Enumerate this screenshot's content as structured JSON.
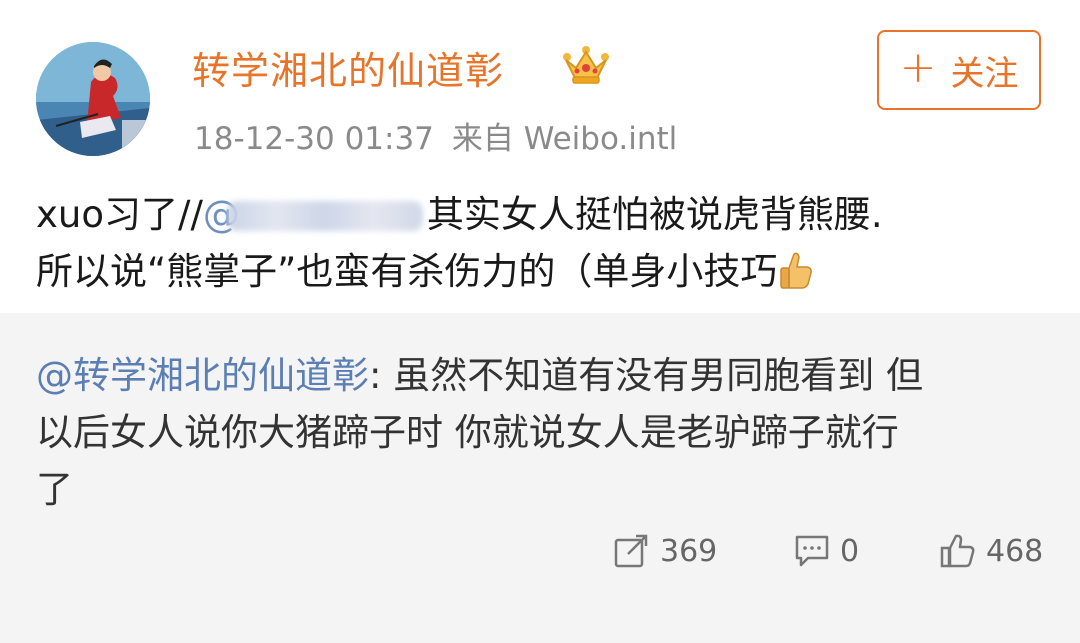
{
  "post": {
    "username": "转学湘北的仙道彰",
    "timestamp": "18-12-30 01:37",
    "source": "来自 Weibo.intl",
    "follow_label": "关注",
    "lines": [
      {
        "before": "xuo习了//",
        "mention": "@",
        "after": "其实女人挺怕被说虎背熊腰."
      },
      {
        "text": "所以说“熊掌子”也蛮有杀伤力的（单身小技巧"
      }
    ]
  },
  "repost": {
    "author": "@转学湘北的仙道彰",
    "text_lines": [
      ": 虽然不知道有没有男同胞看到 但",
      "以后女人说你大猪蹄子时 你就说女人是老驴蹄子就行",
      "了"
    ],
    "stats": {
      "reposts": "369",
      "comments": "0",
      "likes": "468"
    }
  },
  "icons": {
    "crown": "crown-icon",
    "thumbs_up_emoji": "thumbs-up-emoji-icon",
    "repost": "repost-icon",
    "comment": "comment-icon",
    "like": "like-icon"
  },
  "colors": {
    "username": "#e8742a",
    "mention": "#5b7fb5",
    "repost_bg": "#f4f4f4"
  }
}
